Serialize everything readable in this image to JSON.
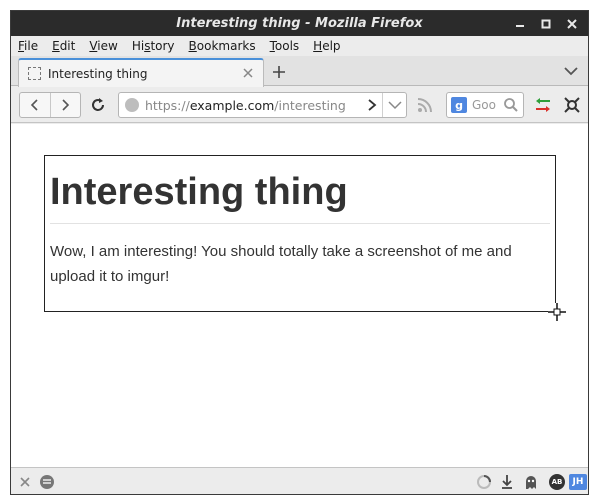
{
  "window": {
    "title": "Interesting thing - Mozilla Firefox",
    "controls": [
      "minimize-icon",
      "maximize-icon",
      "close-icon"
    ]
  },
  "menu": {
    "items": [
      {
        "label": "File",
        "u": "F",
        "rest": "ile"
      },
      {
        "label": "Edit",
        "u": "E",
        "rest": "dit"
      },
      {
        "label": "View",
        "u": "V",
        "rest": "iew"
      },
      {
        "label": "History",
        "pre": "Hi",
        "u": "s",
        "rest": "tory"
      },
      {
        "label": "Bookmarks",
        "u": "B",
        "rest": "ookmarks"
      },
      {
        "label": "Tools",
        "u": "T",
        "rest": "ools"
      },
      {
        "label": "Help",
        "u": "H",
        "rest": "elp"
      }
    ]
  },
  "tabs": [
    {
      "title": "Interesting thing",
      "active": true
    }
  ],
  "nav": {
    "url_scheme": "https://",
    "url_host": "example.com",
    "url_path": "/interesting",
    "search_placeholder": "Goo"
  },
  "page": {
    "heading": "Interesting thing",
    "body": "Wow, I am interesting! You should totally take a screenshot of me and upload it to imgur!"
  },
  "statusbar": {
    "right_badges": {
      "ab": "AB",
      "jh": "JH"
    }
  },
  "colors": {
    "titlebar": "#2b2b2b",
    "tab_accent": "#4a90d9",
    "search_engine": "#4f87e0"
  }
}
